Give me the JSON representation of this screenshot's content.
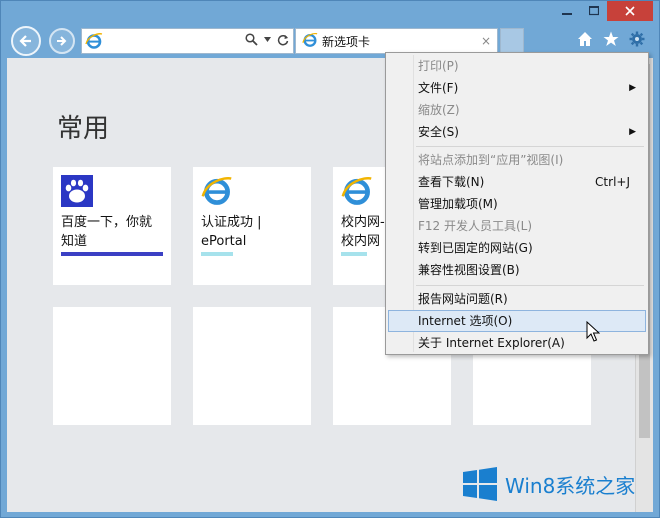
{
  "tab": {
    "title": "新选项卡",
    "close_glyph": "×"
  },
  "address": {
    "value": ""
  },
  "section": {
    "title": "常用"
  },
  "tiles": [
    {
      "line1": "百度一下，你就",
      "line2": "知道",
      "icon": "baidu-paw-icon",
      "bar_color": "#3b40c4"
    },
    {
      "line1": "认证成功 |",
      "line2": "ePortal",
      "icon": "ie-icon",
      "bar_color": "#a6e2ec"
    },
    {
      "line1": "校内网-",
      "line2": "校内网",
      "icon": "ie-icon",
      "bar_color": "#a6e2ec"
    }
  ],
  "menu": {
    "items": [
      {
        "label": "打印(P)",
        "disabled": true
      },
      {
        "label": "文件(F)",
        "submenu": true
      },
      {
        "label": "缩放(Z)",
        "disabled": true
      },
      {
        "label": "安全(S)",
        "submenu": true
      },
      {
        "label": "将站点添加到“应用”视图(I)",
        "disabled": true
      },
      {
        "label": "查看下载(N)",
        "shortcut": "Ctrl+J"
      },
      {
        "label": "管理加载项(M)"
      },
      {
        "label": "F12 开发人员工具(L)",
        "disabled": true
      },
      {
        "label": "转到已固定的网站(G)"
      },
      {
        "label": "兼容性视图设置(B)"
      },
      {
        "label": "报告网站问题(R)"
      },
      {
        "label": "Internet 选项(O)",
        "hover": true
      },
      {
        "label": "关于 Internet Explorer(A)"
      }
    ]
  },
  "watermark": {
    "text": "Win8系统之家"
  },
  "colors": {
    "frame": "#71a8d6",
    "close_button": "#c7413a",
    "accent": "#1a7fcf"
  }
}
